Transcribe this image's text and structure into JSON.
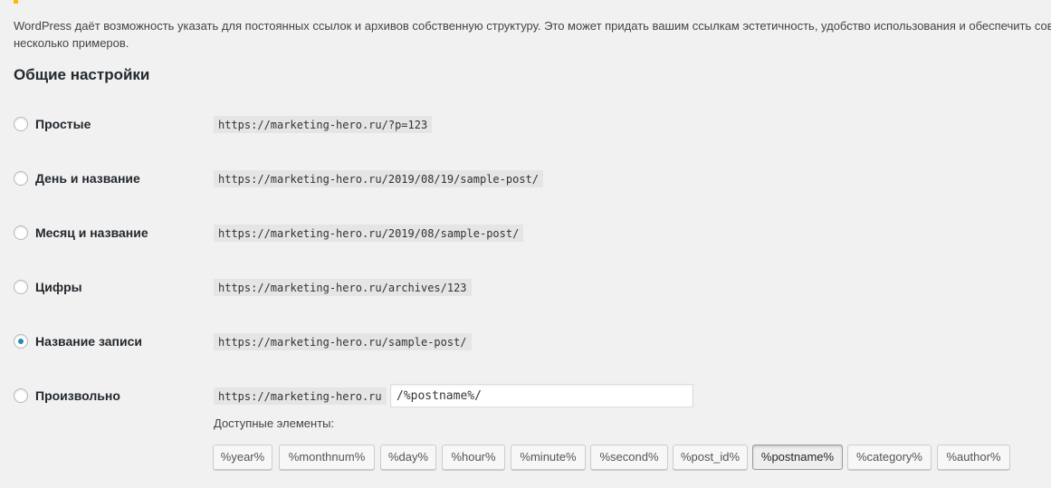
{
  "intro": {
    "line1": "WordPress даёт возможность указать для постоянных ссылок и архивов собственную структуру. Это может придать вашим ссылкам эстетичность, удобство использования и обеспечить совме",
    "line2": "несколько примеров."
  },
  "section_title": "Общие настройки",
  "options": [
    {
      "label": "Простые",
      "example": "https://marketing-hero.ru/?p=123",
      "checked": false
    },
    {
      "label": "День и название",
      "example": "https://marketing-hero.ru/2019/08/19/sample-post/",
      "checked": false
    },
    {
      "label": "Месяц и название",
      "example": "https://marketing-hero.ru/2019/08/sample-post/",
      "checked": false
    },
    {
      "label": "Цифры",
      "example": "https://marketing-hero.ru/archives/123",
      "checked": false
    },
    {
      "label": "Название записи",
      "example": "https://marketing-hero.ru/sample-post/",
      "checked": true
    },
    {
      "label": "Произвольно",
      "example": "https://marketing-hero.ru",
      "checked": false
    }
  ],
  "custom_structure": {
    "value": "/%postname%/"
  },
  "available_label": "Доступные элементы:",
  "tags": [
    {
      "label": "%year%",
      "active": false
    },
    {
      "label": "%monthnum%",
      "active": false
    },
    {
      "label": "%day%",
      "active": false
    },
    {
      "label": "%hour%",
      "active": false
    },
    {
      "label": "%minute%",
      "active": false
    },
    {
      "label": "%second%",
      "active": false
    },
    {
      "label": "%post_id%",
      "active": false
    },
    {
      "label": "%postname%",
      "active": true
    },
    {
      "label": "%category%",
      "active": false
    },
    {
      "label": "%author%",
      "active": false
    }
  ],
  "colors": {
    "radio_checked": "#1e8cbe",
    "notice_accent": "#ffb900"
  }
}
